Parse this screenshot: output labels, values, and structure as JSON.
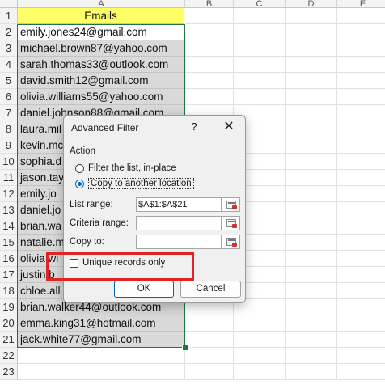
{
  "columns": [
    "A",
    "B",
    "C",
    "D",
    "E"
  ],
  "rows": [
    "1",
    "2",
    "3",
    "4",
    "5",
    "6",
    "7",
    "8",
    "9",
    "10",
    "11",
    "12",
    "13",
    "14",
    "15",
    "16",
    "17",
    "18",
    "19",
    "20",
    "21",
    "22",
    "23"
  ],
  "cells": [
    "Emails",
    "emily.jones24@gmail.com",
    "michael.brown87@yahoo.com",
    "sarah.thomas33@outlook.com",
    "david.smith12@gmail.com",
    "olivia.williams55@yahoo.com",
    "daniel.johnson88@gmail.com",
    "laura.mil",
    "kevin.mc",
    "sophia.d",
    "jason.tay",
    "emily.jo",
    "daniel.jo",
    "brian.wa",
    "natalie.m",
    "olivia.wi",
    "justin.b",
    "chloe.all",
    "brian.walker44@outlook.com",
    "emma.king31@hotmail.com",
    "jack.white77@gmail.com",
    "",
    ""
  ],
  "dialog": {
    "title": "Advanced Filter",
    "help": "?",
    "close": "✕",
    "action_label": "Action",
    "radio_filter_in_place": "Filter the list, in-place",
    "radio_copy_to_location": "Copy to another location",
    "selected_action": "Copy to another location",
    "list_range_label": "List range:",
    "list_range_value": "$A$1:$A$21",
    "criteria_range_label": "Criteria range:",
    "criteria_range_value": "",
    "copy_to_label": "Copy to:",
    "copy_to_value": "",
    "unique_records_label": "Unique records only",
    "unique_records_checked": false,
    "ok_label": "OK",
    "cancel_label": "Cancel"
  },
  "colors": {
    "header_fill": "#ffff66",
    "selection_fill": "#d9d9d9",
    "selection_border": "#217346",
    "highlight": "#e02424",
    "accent": "#0063b1"
  }
}
